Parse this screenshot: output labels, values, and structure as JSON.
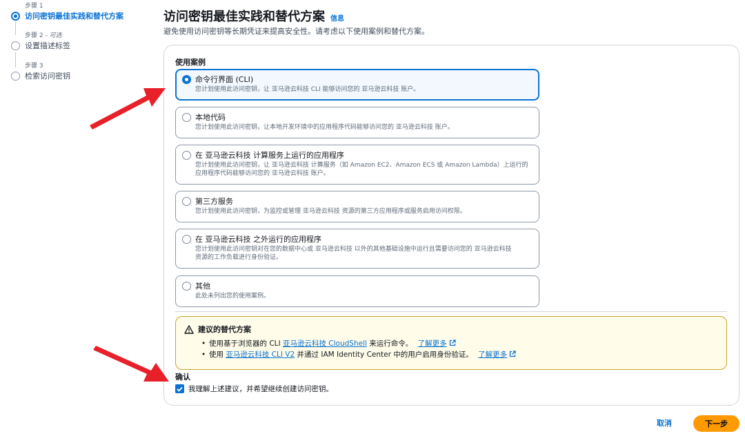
{
  "steps": [
    {
      "meta": "步骤 1",
      "optional": "",
      "title": "访问密钥最佳实践和替代方案",
      "active": true
    },
    {
      "meta": "步骤 2 - ",
      "optional": "可选",
      "title": "设置描述标签",
      "active": false
    },
    {
      "meta": "步骤 3",
      "optional": "",
      "title": "检索访问密钥",
      "active": false
    }
  ],
  "header": {
    "title": "访问密钥最佳实践和替代方案",
    "info": "信息",
    "description": "避免使用访问密钥等长期凭证来提高安全性。请考虑以下使用案例和替代方案。"
  },
  "use_cases": {
    "label": "使用案例",
    "selected_index": 0,
    "options": [
      {
        "title": "命令行界面 (CLI)",
        "desc": [
          "您计划使用此访问密钥，让 亚马逊云科技 CLI 能够访问您的 亚马逊云科技 账户。"
        ]
      },
      {
        "title": "本地代码",
        "desc": [
          "您计划使用此访问密钥，让本地开发环境中的应用程序代码能够访问您的 亚马逊云科技 账户。"
        ]
      },
      {
        "title": "在 亚马逊云科技 计算服务上运行的应用程序",
        "desc": [
          "您计划使用此访问密钥，让 亚马逊云科技 计算服务（如 Amazon EC2、Amazon ECS 或 Amazon Lambda）上运行的",
          "应用程序代码能够访问您的 亚马逊云科技 账户。"
        ]
      },
      {
        "title": "第三方服务",
        "desc": [
          "您计划使用此访问密钥，为监控或管理 亚马逊云科技 资源的第三方应用程序或服务启用访问权限。"
        ]
      },
      {
        "title": "在 亚马逊云科技 之外运行的应用程序",
        "desc": [
          "您计划使用此访问密钥对在您的数据中心或 亚马逊云科技 以外的其他基础设施中运行且需要访问您的 亚马逊云科技",
          "资源的工作负载进行身份验证。"
        ]
      },
      {
        "title": "其他",
        "desc": [
          "此处未列出您的使用案例。"
        ]
      }
    ]
  },
  "alert": {
    "title": "建议的替代方案",
    "items": [
      {
        "before": "使用基于浏览器的 CLI ",
        "link": "亚马逊云科技 CloudShell",
        "after": " 来运行命令。",
        "learn_more": "了解更多"
      },
      {
        "before": "使用 ",
        "link": "亚马逊云科技 CLI V2",
        "after": " 并通过 IAM Identity Center 中的用户启用身份验证。",
        "learn_more": "了解更多"
      }
    ]
  },
  "confirm": {
    "label": "确认",
    "checkbox_text": "我理解上述建议，并希望继续创建访问密钥。",
    "checked": true
  },
  "footer": {
    "cancel": "取消",
    "next": "下一步"
  },
  "colors": {
    "accent": "#0972d3",
    "primary_button": "#ff9900",
    "warning_border": "#c9a42a",
    "annotation_arrow": "#e8202a"
  }
}
